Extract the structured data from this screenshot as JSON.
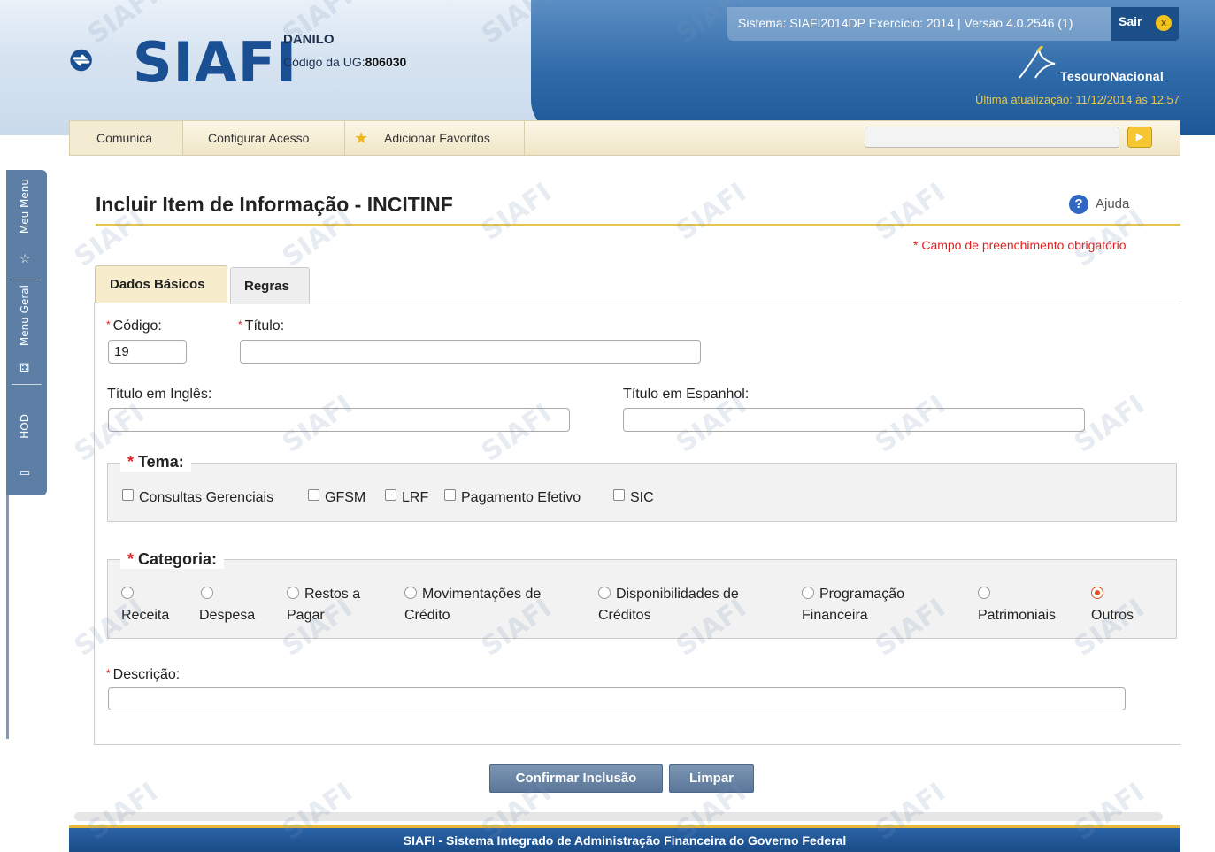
{
  "header": {
    "logo_text": "SIAFI",
    "user_name": "DANILO",
    "ug_label": "Código da UG:",
    "ug_value": "806030",
    "system_info": "Sistema: SIAFI2014DP Exercício: 2014 | Versão 4.0.2546 (1)",
    "logout_label": "Sair",
    "logout_icon": "x",
    "tesouro_label": "TesouroNacional",
    "last_update": "Última atualização: 11/12/2014 às 12:57"
  },
  "side_tabs": [
    {
      "label": "Meu Menu",
      "icon": "star-icon"
    },
    {
      "label": "Menu Geral",
      "icon": "sitemap-icon"
    },
    {
      "label": "HOD",
      "icon": "monitor-icon"
    }
  ],
  "toolbar": {
    "items": [
      "Comunica",
      "Configurar Acesso",
      "Adicionar Favoritos"
    ],
    "search_value": "",
    "go_icon": "arrow-right-icon"
  },
  "page": {
    "title": "Incluir Item de Informação - INCITINF",
    "help_label": "Ajuda",
    "required_note": "* Campo de preenchimento obrigatório"
  },
  "tabs": [
    "Dados Básicos",
    "Regras"
  ],
  "form": {
    "codigo_label": "Código:",
    "codigo_value": "19",
    "titulo_label": "Título:",
    "titulo_value": "",
    "titulo_ingles_label": "Título em Inglês:",
    "titulo_ingles_value": "",
    "titulo_espanhol_label": "Título em Espanhol:",
    "titulo_espanhol_value": "",
    "tema_legend": "Tema:",
    "tema_options": [
      {
        "label": "Consultas Gerenciais",
        "checked": false
      },
      {
        "label": "GFSM",
        "checked": false
      },
      {
        "label": "LRF",
        "checked": false
      },
      {
        "label": "Pagamento Efetivo",
        "checked": false
      },
      {
        "label": "SIC",
        "checked": false
      }
    ],
    "categoria_legend": "Categoria:",
    "categoria_options": [
      {
        "line1": "",
        "line2": "Receita",
        "selected": false
      },
      {
        "line1": "",
        "line2": "Despesa",
        "selected": false
      },
      {
        "line1": "Restos a",
        "line2": "Pagar",
        "selected": false
      },
      {
        "line1": "Movimentações de",
        "line2": "Crédito",
        "selected": false
      },
      {
        "line1": "Disponibilidades de",
        "line2": "Créditos",
        "selected": false
      },
      {
        "line1": "Programação",
        "line2": "Financeira",
        "selected": false
      },
      {
        "line1": "",
        "line2": "Patrimoniais",
        "selected": false
      },
      {
        "line1": "",
        "line2": "Outros",
        "selected": true
      }
    ],
    "descricao_label": "Descrição:",
    "descricao_value": ""
  },
  "buttons": {
    "confirm": "Confirmar Inclusão",
    "clear": "Limpar"
  },
  "footer": "SIAFI - Sistema Integrado de Administração Financeira do Governo Federal",
  "colors": {
    "required": "#e02020",
    "accent_gold": "#e8c34c",
    "header_blue": "#1d5797",
    "button": "#5a7699"
  }
}
